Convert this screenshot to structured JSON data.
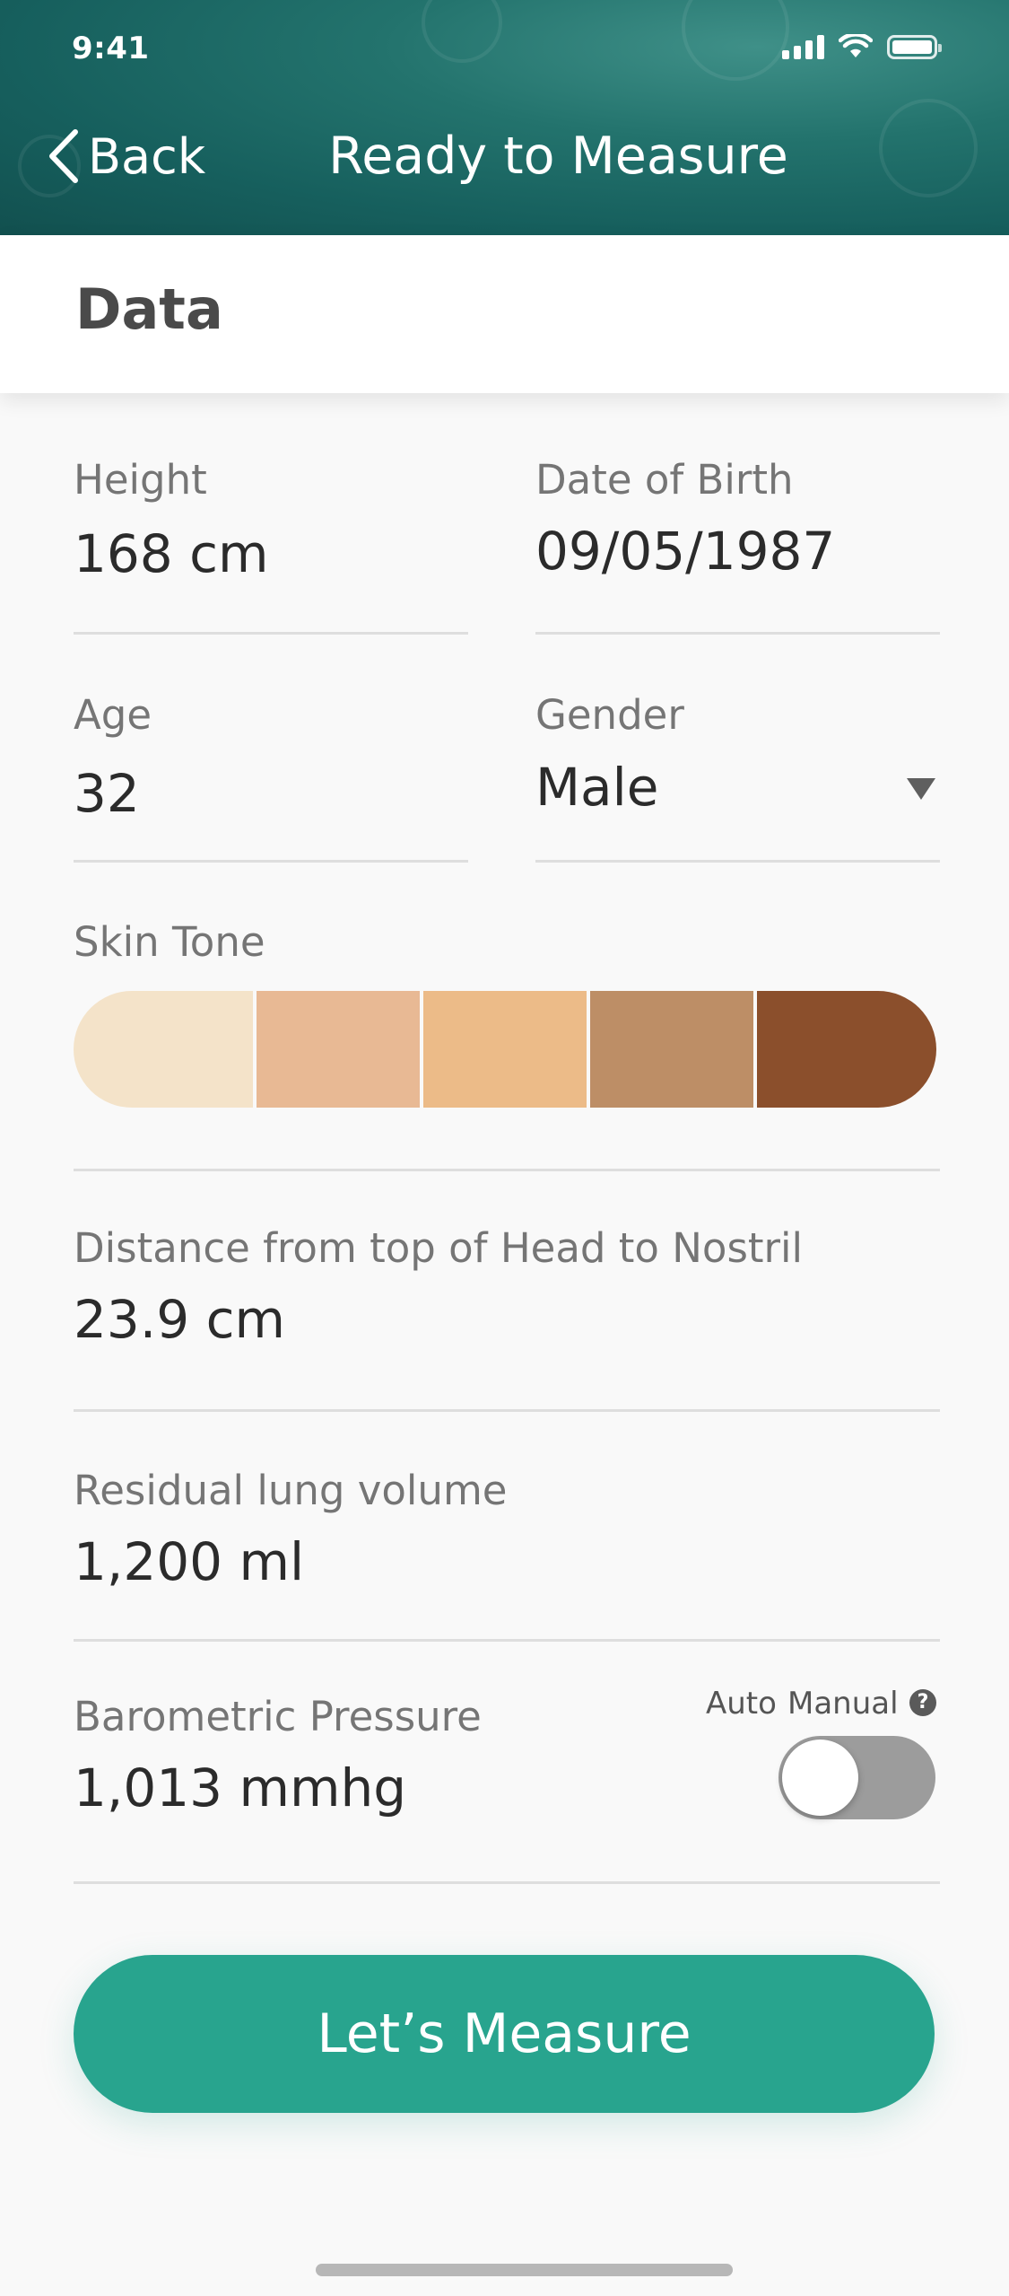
{
  "status_bar": {
    "time": "9:41"
  },
  "nav": {
    "back_label": "Back",
    "title": "Ready to Measure"
  },
  "section": {
    "title": "Data"
  },
  "fields": {
    "height": {
      "label": "Height",
      "value": "168 cm"
    },
    "dob": {
      "label": "Date of Birth",
      "value": "09/05/1987"
    },
    "age": {
      "label": "Age",
      "value": "32"
    },
    "gender": {
      "label": "Gender",
      "value": "Male"
    },
    "skin_tone": {
      "label": "Skin Tone",
      "swatches": [
        "#f4e3c9",
        "#e8b994",
        "#ecbb88",
        "#bd8e66",
        "#8b4f2c"
      ]
    },
    "head_nostril": {
      "label": "Distance from top of Head to Nostril",
      "value": "23.9 cm"
    },
    "lung_volume": {
      "label": "Residual lung volume",
      "value": "1,200 ml"
    },
    "pressure": {
      "label": "Barometric Pressure",
      "value": "1,013 mmhg",
      "mode_auto": "Auto",
      "mode_manual": "Manual",
      "help": "?"
    }
  },
  "cta": {
    "label": "Let’s Measure"
  },
  "colors": {
    "accent": "#28a48e",
    "header": "#1c6b67"
  }
}
